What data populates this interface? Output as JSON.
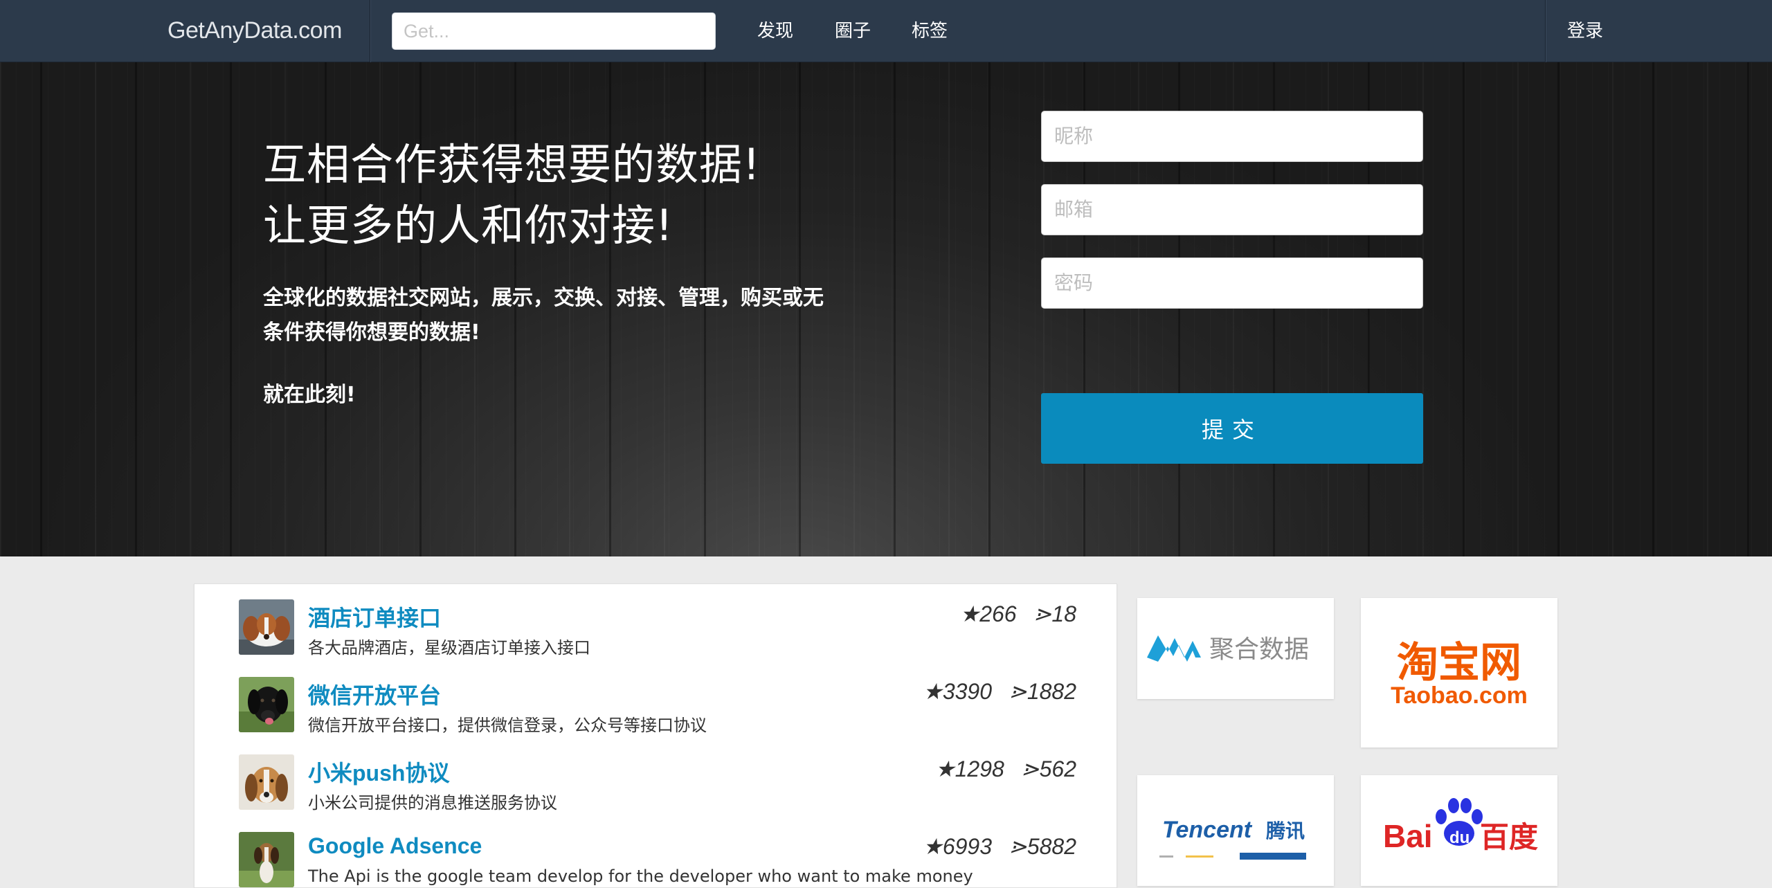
{
  "navbar": {
    "brand": "GetAnyData.com",
    "search_placeholder": "Get...",
    "links": [
      "发现",
      "圈子",
      "标签"
    ],
    "login": "登录"
  },
  "hero": {
    "title_line1": "互相合作获得想要的数据!",
    "title_line2": "让更多的人和你对接!",
    "description": "全球化的数据社交网站，展示，交换、对接、管理，购买或无条件获得你想要的数据!",
    "now": "就在此刻!"
  },
  "signup": {
    "nickname_placeholder": "昵称",
    "email_placeholder": "邮箱",
    "password_placeholder": "密码",
    "submit_label": "提交"
  },
  "apis": [
    {
      "title": "酒店订单接口",
      "desc": "各大品牌酒店，星级酒店订单接入接口",
      "stars": "★266",
      "forks": "⋗18"
    },
    {
      "title": "微信开放平台",
      "desc": "微信开放平台接口，提供微信登录，公众号等接口协议",
      "stars": "★3390",
      "forks": "⋗1882"
    },
    {
      "title": "小米push协议",
      "desc": "小米公司提供的消息推送服务协议",
      "stars": "★1298",
      "forks": "⋗562"
    },
    {
      "title": "Google Adsence",
      "desc": "The Api is the google team develop for the developer who want to make money",
      "stars": "★6993",
      "forks": "⋗5882"
    }
  ],
  "partners": {
    "juhe": "聚合数据",
    "taobao_cn": "淘宝网",
    "taobao_en": "Taobao.com",
    "tencent_en": "Tencent",
    "tencent_cn": "腾讯",
    "baidu_bai": "Bai",
    "baidu_du": "du",
    "baidu_cn": "百度"
  },
  "colors": {
    "navbar": "#2c3a4b",
    "accent": "#0a8bbd",
    "link": "#0f8bc0",
    "taobao": "#f05a00",
    "baidu_red": "#de2626",
    "baidu_blue": "#2932e1",
    "tencent_blue": "#1d5fa8"
  }
}
